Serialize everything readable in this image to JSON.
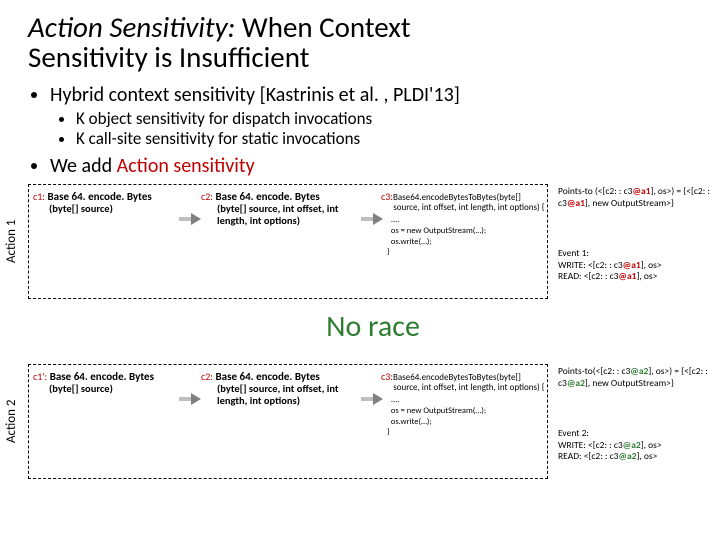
{
  "title": {
    "emph": "Action Sensitivity:",
    "rest1": " When Context",
    "line2": "Sensitivity is Insufficient"
  },
  "bullets": {
    "top1": "Hybrid context sensitivity [Kastrinis et al. , PLDI'13]",
    "sub1": "K object sensitivity for dispatch invocations",
    "sub2": "K call-site sensitivity for static invocations",
    "top2_pre": "We add ",
    "top2_emph": "Action sensitivity"
  },
  "labels": {
    "action1": "Action 1",
    "action2": "Action 2"
  },
  "trace1": {
    "c1_label": "c1:",
    "c1_fn": "Base 64. encode. Bytes",
    "c1_sig": "(byte[] source)",
    "c2_label": "c2:",
    "c2_fn": "Base 64. encode. Bytes",
    "c2_sig": "(byte[] source, int offset, int length, int options)",
    "c3_label": "c3:",
    "c3_fn": "Base64.encodeBytesToBytes(byte[]\n      source, int offset, int length, int options) {",
    "c3_code": "  ....\n  os = new OutputStream(…);\n  os.write(…);\n}"
  },
  "trace2": {
    "c1_label": "c1':",
    "c1_fn": "Base 64. encode. Bytes",
    "c1_sig": "(byte[] source)",
    "c2_label": "c2:",
    "c2_fn": "Base 64. encode. Bytes",
    "c2_sig": "(byte[] source, int offset, int length, int options)",
    "c3_label": "c3:",
    "c3_fn": "Base64.encodeBytesToBytes(byte[]\n      source, int offset, int length, int options) {",
    "c3_code": "  ....\n  os = new OutputStream(…);\n  os.write(…);\n}"
  },
  "notes1": {
    "pts_pre": "Points-to (<[c2: : c3",
    "pts_alloc": "@a1",
    "pts_mid": "], os>) = {<[c2: : c3",
    "pts_mid2": "], new OutputStream>}",
    "evt_title": "Event 1:",
    "evt_w_pre": "WRITE: <[c2: : c3",
    "evt_w_post": "], os>",
    "evt_r_pre": "READ: <[c2: : c3",
    "evt_r_post": "], os>"
  },
  "notes2": {
    "pts_pre": "Points-to(<[c2: : c3",
    "pts_alloc": "@a2",
    "pts_mid": "], os>) = {<[c2: : c3",
    "pts_mid2": "], new OutputStream>}",
    "evt_title": "Event 2:",
    "evt_w_pre": "WRITE: <[c2: : c3",
    "evt_w_post": "], os>",
    "evt_r_pre": "READ: <[c2: : c3",
    "evt_r_post": "], os>"
  },
  "no_race": "No race"
}
